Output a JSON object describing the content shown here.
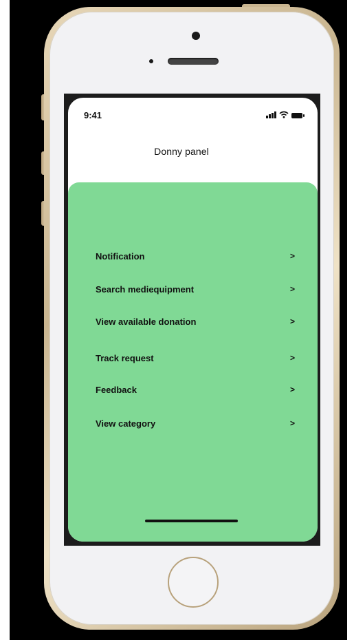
{
  "status_bar": {
    "time": "9:41",
    "icons": [
      "signal-icon",
      "wifi-icon",
      "battery-icon"
    ]
  },
  "header": {
    "title": "Donny panel"
  },
  "menu": {
    "items": [
      {
        "label": "Notification",
        "chevron": ">"
      },
      {
        "label": "Search mediequipment",
        "chevron": ">"
      },
      {
        "label": "View available donation",
        "chevron": ">"
      },
      {
        "label": "Track request",
        "chevron": ">"
      },
      {
        "label": "Feedback",
        "chevron": ">"
      },
      {
        "label": "View category",
        "chevron": ">"
      }
    ]
  },
  "colors": {
    "panel_background": "#80d995",
    "device_frame": "#c9b590",
    "background": "#000000"
  }
}
